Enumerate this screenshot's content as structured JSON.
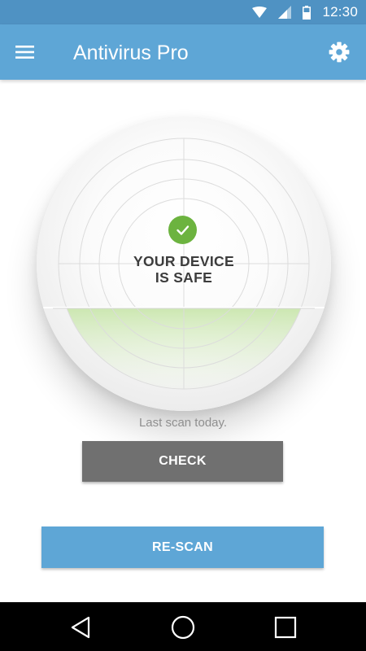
{
  "status_bar": {
    "time": "12:30",
    "icons": [
      "wifi-icon",
      "signal-icon",
      "battery-icon"
    ]
  },
  "app_bar": {
    "title": "Antivirus Pro",
    "menu_icon": "menu-icon",
    "settings_icon": "gear-icon"
  },
  "dial": {
    "status_line1": "YOUR DEVICE",
    "status_line2": "IS SAFE",
    "status_icon": "check-icon"
  },
  "scan": {
    "last_scan": "Last scan today.",
    "check_label": "CHECK",
    "rescan_label": "RE-SCAN"
  },
  "nav": {
    "icons": [
      "back-icon",
      "home-icon",
      "recents-icon"
    ]
  },
  "colors": {
    "status_bar": "#4f92c3",
    "app_bar": "#5ea6d6",
    "safe_green": "#6cb33f",
    "check_button": "#707070",
    "rescan_button": "#5ea6d6"
  }
}
